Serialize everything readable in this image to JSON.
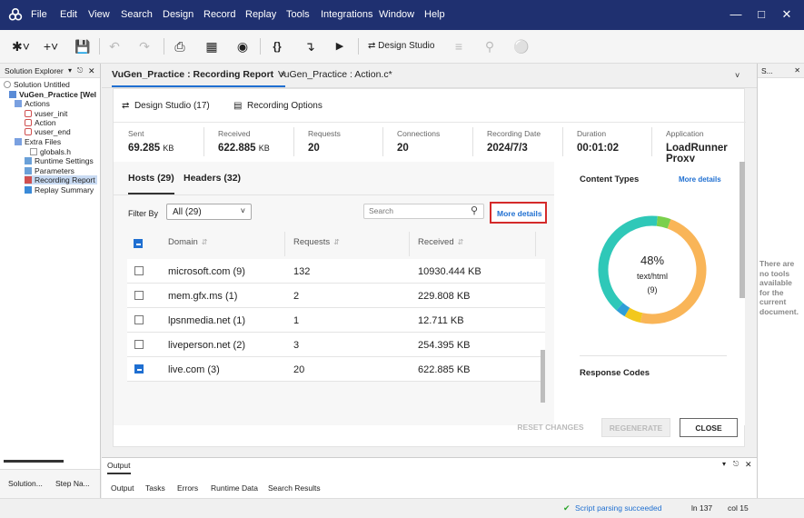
{
  "menu": [
    "File",
    "Edit",
    "View",
    "Search",
    "Design",
    "Record",
    "Replay",
    "Tools",
    "Integrations",
    "Window",
    "Help"
  ],
  "toolbar": {
    "design_studio": "Design Studio"
  },
  "solution_explorer": {
    "title": "Solution Explorer",
    "items": [
      {
        "label": "Solution Untitled"
      },
      {
        "label": "VuGen_Practice [Wel"
      },
      {
        "label": "Actions"
      },
      {
        "label": "vuser_init"
      },
      {
        "label": "Action"
      },
      {
        "label": "vuser_end"
      },
      {
        "label": "Extra Files"
      },
      {
        "label": "globals.h"
      },
      {
        "label": "Runtime Settings"
      },
      {
        "label": "Parameters"
      },
      {
        "label": "Recording Report"
      },
      {
        "label": "Replay Summary"
      }
    ],
    "bottom_tabs": [
      "Solution...",
      "Step Na..."
    ]
  },
  "doc_tabs": [
    {
      "label": "VuGen_Practice : Recording Report",
      "close": "×"
    },
    {
      "label": "VuGen_Practice : Action.c*"
    }
  ],
  "report": {
    "design_studio": "Design Studio (17)",
    "recording_options": "Recording Options",
    "stats": [
      {
        "label": "Sent",
        "value": "69.285",
        "unit": "KB"
      },
      {
        "label": "Received",
        "value": "622.885",
        "unit": "KB"
      },
      {
        "label": "Requests",
        "value": "20",
        "unit": ""
      },
      {
        "label": "Connections",
        "value": "20",
        "unit": ""
      },
      {
        "label": "Recording Date",
        "value": "2024/7/3",
        "unit": ""
      },
      {
        "label": "Duration",
        "value": "00:01:02",
        "unit": ""
      },
      {
        "label": "Application",
        "value": "LoadRunner",
        "value2": "Proxy",
        "unit": ""
      }
    ],
    "hosts_tab": "Hosts (29)",
    "headers_tab": "Headers (32)",
    "filter_label": "Filter By",
    "filter_value": "All (29)",
    "search_placeholder": "Search",
    "more_details": "More details",
    "columns": [
      "Domain",
      "Requests",
      "Received"
    ],
    "rows": [
      {
        "domain": "microsoft.com (9)",
        "requests": "132",
        "received": "10930.444 KB",
        "checked": false
      },
      {
        "domain": "mem.gfx.ms (1)",
        "requests": "2",
        "received": "229.808 KB",
        "checked": false
      },
      {
        "domain": "lpsnmedia.net (1)",
        "requests": "1",
        "received": "12.711 KB",
        "checked": false
      },
      {
        "domain": "liveperson.net (2)",
        "requests": "3",
        "received": "254.395 KB",
        "checked": false
      },
      {
        "domain": "live.com (3)",
        "requests": "20",
        "received": "622.885 KB",
        "checked": true
      }
    ],
    "content_types": {
      "title": "Content Types",
      "more_details": "More details",
      "percent": "48%",
      "type": "text/html",
      "count": "(9)"
    },
    "response_codes": "Response Codes",
    "buttons": {
      "reset": "RESET CHANGES",
      "regenerate": "REGENERATE",
      "close": "CLOSE"
    }
  },
  "chart_data": {
    "type": "pie",
    "title": "Content Types",
    "center_label": "48%",
    "center_sublabel": "text/html",
    "center_count": "(9)",
    "slices": [
      {
        "value": 48,
        "color": "#f9b558"
      },
      {
        "value": 5,
        "color": "#f2c81d"
      },
      {
        "value": 3,
        "color": "#2f9fd8"
      },
      {
        "value": 40,
        "color": "#2fc8b8"
      },
      {
        "value": 4,
        "color": "#7ad04c"
      }
    ]
  },
  "side_panel": {
    "title": "S...",
    "message": [
      "There are",
      "no tools",
      "available",
      "for the",
      "current",
      "document."
    ]
  },
  "output": {
    "title": "Output",
    "tabs": [
      "Output",
      "Tasks",
      "Errors",
      "Runtime Data",
      "Search Results"
    ]
  },
  "status": {
    "message": "Script parsing succeeded",
    "line": "ln 137",
    "col": "col 15"
  },
  "colors": {
    "titlebar": "#1f3070",
    "accent": "#1f6fd1",
    "highlight_box": "#d42a2a"
  }
}
